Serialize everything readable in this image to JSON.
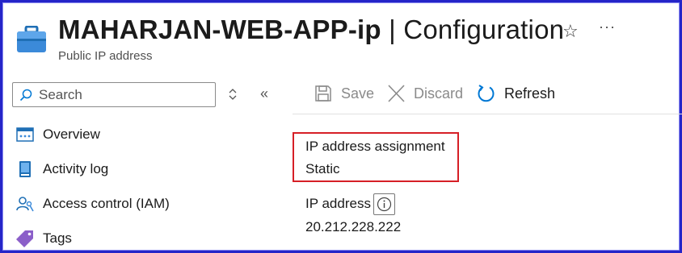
{
  "header": {
    "resource_name": "MAHARJAN-WEB-APP-ip",
    "separator": " | ",
    "section": "Configuration",
    "subtitle": "Public IP address",
    "star_icon": "star-icon",
    "more_label": "···"
  },
  "sidebar": {
    "search_placeholder": "Search",
    "collapse_label": "«",
    "items": [
      {
        "label": "Overview",
        "icon": "overview-icon"
      },
      {
        "label": "Activity log",
        "icon": "activity-log-icon"
      },
      {
        "label": "Access control (IAM)",
        "icon": "access-control-icon"
      },
      {
        "label": "Tags",
        "icon": "tag-icon"
      }
    ]
  },
  "toolbar": {
    "save_label": "Save",
    "discard_label": "Discard",
    "refresh_label": "Refresh"
  },
  "main": {
    "assignment_label": "IP address assignment",
    "assignment_value": "Static",
    "ip_label": "IP address",
    "ip_value": "20.212.228.222"
  },
  "colors": {
    "frame": "#2525c8",
    "highlight": "#d61f26",
    "accent": "#0078d4"
  }
}
